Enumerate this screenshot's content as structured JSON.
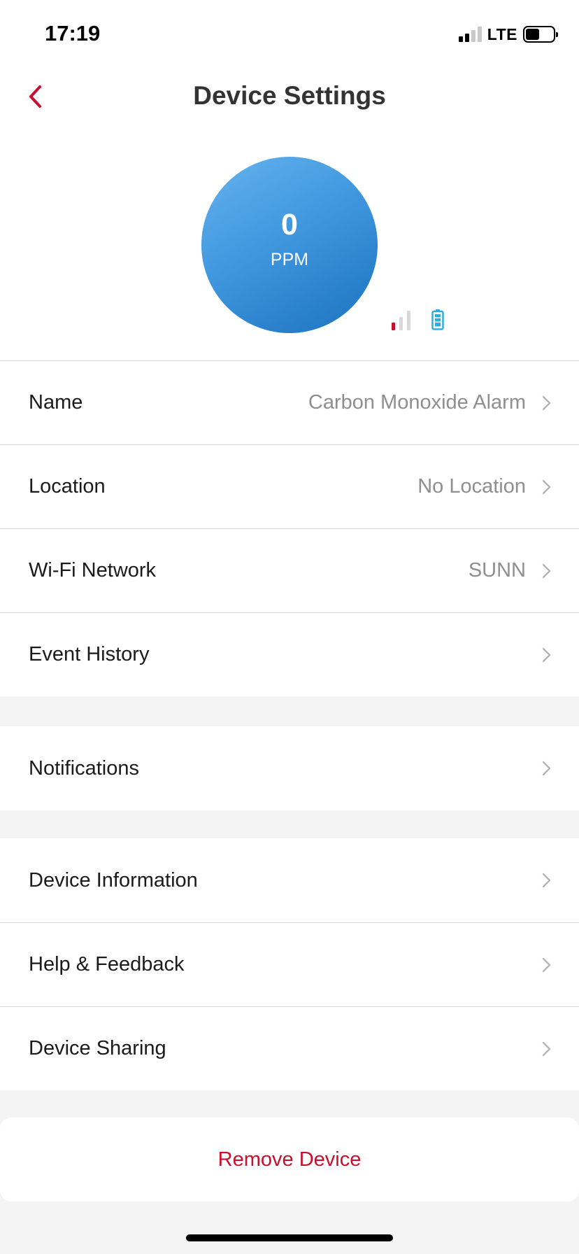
{
  "status_bar": {
    "time": "17:19",
    "network": "LTE",
    "signal_bars_on": 2,
    "signal_bars_total": 4,
    "battery_level": 0.5
  },
  "header": {
    "title": "Device Settings",
    "back_icon": "chevron-left-icon"
  },
  "reading": {
    "value": "0",
    "unit": "PPM",
    "wifi_strength_bars": 1,
    "wifi_strength_total": 3,
    "battery_icon": "battery-full-icon"
  },
  "groups": {
    "main": [
      {
        "label": "Name",
        "value": "Carbon Monoxide Alarm"
      },
      {
        "label": "Location",
        "value": "No Location"
      },
      {
        "label": "Wi-Fi Network",
        "value": "SUNN"
      },
      {
        "label": "Event History",
        "value": ""
      }
    ],
    "notifications": [
      {
        "label": "Notifications",
        "value": ""
      }
    ],
    "info": [
      {
        "label": "Device Information",
        "value": ""
      },
      {
        "label": "Help & Feedback",
        "value": ""
      },
      {
        "label": "Device Sharing",
        "value": ""
      }
    ]
  },
  "remove_label": "Remove Device",
  "colors": {
    "accent": "#c8102e",
    "gauge_start": "#64b4ee",
    "gauge_end": "#1b72be",
    "battery_icon": "#2ab0e0"
  }
}
